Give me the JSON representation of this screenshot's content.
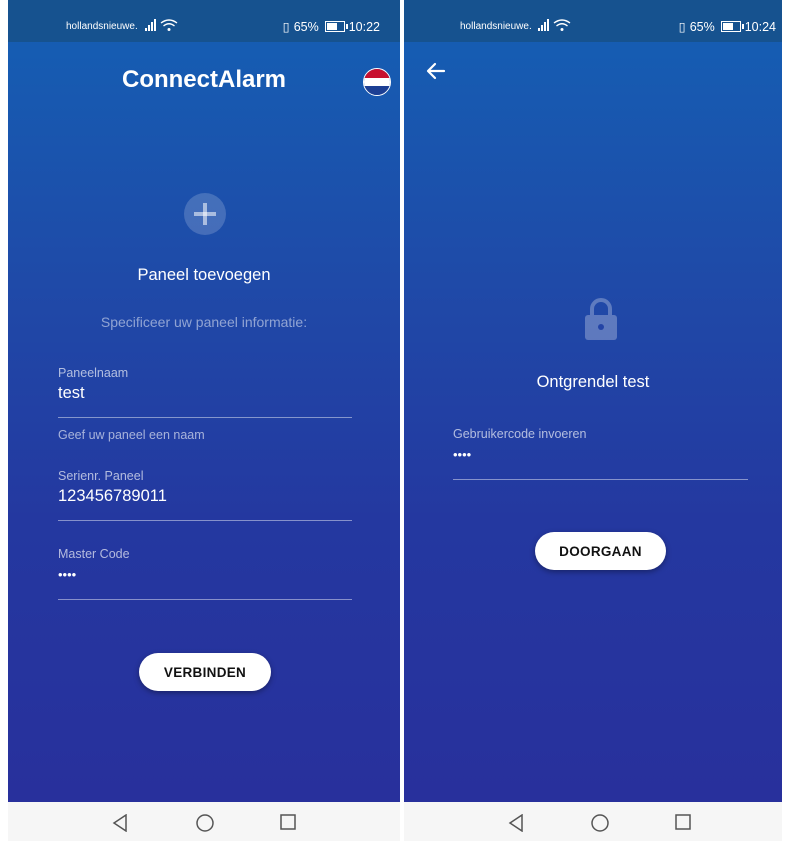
{
  "left_screen": {
    "status": {
      "carrier": "hollandsnieuwe.",
      "battery": "65%",
      "time": "10:22"
    },
    "app_title": "ConnectAlarm",
    "icons": {
      "language": "netherlands-flag-icon",
      "add": "plus-circle-icon"
    },
    "title": "Paneel toevoegen",
    "subtitle": "Specificeer uw paneel informatie:",
    "fields": [
      {
        "label": "Paneelnaam",
        "value": "test",
        "helper": "Geef uw paneel een naam"
      },
      {
        "label": "Serienr. Paneel",
        "value": "123456789011"
      },
      {
        "label": "Master Code",
        "value": "••••"
      }
    ],
    "button": "VERBINDEN"
  },
  "right_screen": {
    "status": {
      "carrier": "hollandsnieuwe.",
      "battery": "65%",
      "time": "10:24"
    },
    "icons": {
      "back": "arrow-left-icon",
      "lock": "lock-icon"
    },
    "title": "Ontgrendel test",
    "field": {
      "label": "Gebruikercode invoeren",
      "value": "••••"
    },
    "button": "DOORGAAN"
  },
  "navbar": {
    "icons": [
      "back-triangle-icon",
      "home-circle-icon",
      "recents-square-icon"
    ]
  },
  "colors": {
    "status_bar": "#16528f",
    "gradient_top": "#1460b4",
    "gradient_bottom": "#28309c",
    "button_bg": "#ffffff",
    "navbar_bg": "#f6f6f6"
  }
}
